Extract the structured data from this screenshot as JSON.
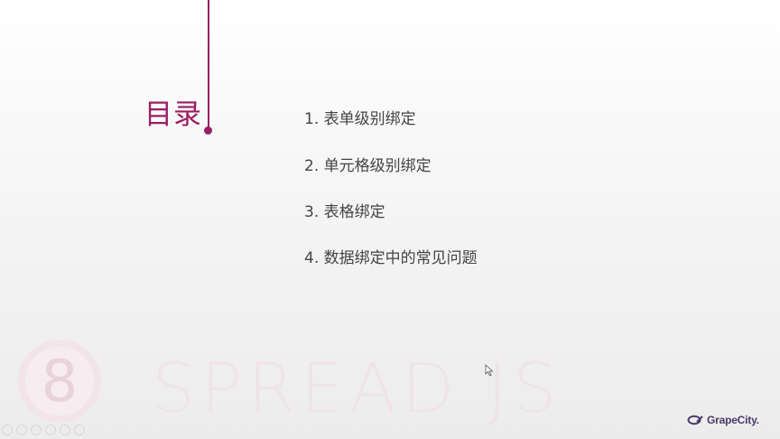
{
  "slide": {
    "title": "目录",
    "items": [
      "1. 表单级别绑定",
      "2. 单元格级别绑定",
      "3. 表格绑定",
      "4. 数据绑定中的常见问题"
    ],
    "watermark_text": "SPREAD JS",
    "watermark_badge_text": "8",
    "brand": "GrapeCity.",
    "accent_color": "#9b1e63"
  },
  "player_controls": [
    "previous-icon",
    "play-icon",
    "next-icon",
    "screenshot-icon",
    "zoom-icon",
    "more-icon"
  ]
}
